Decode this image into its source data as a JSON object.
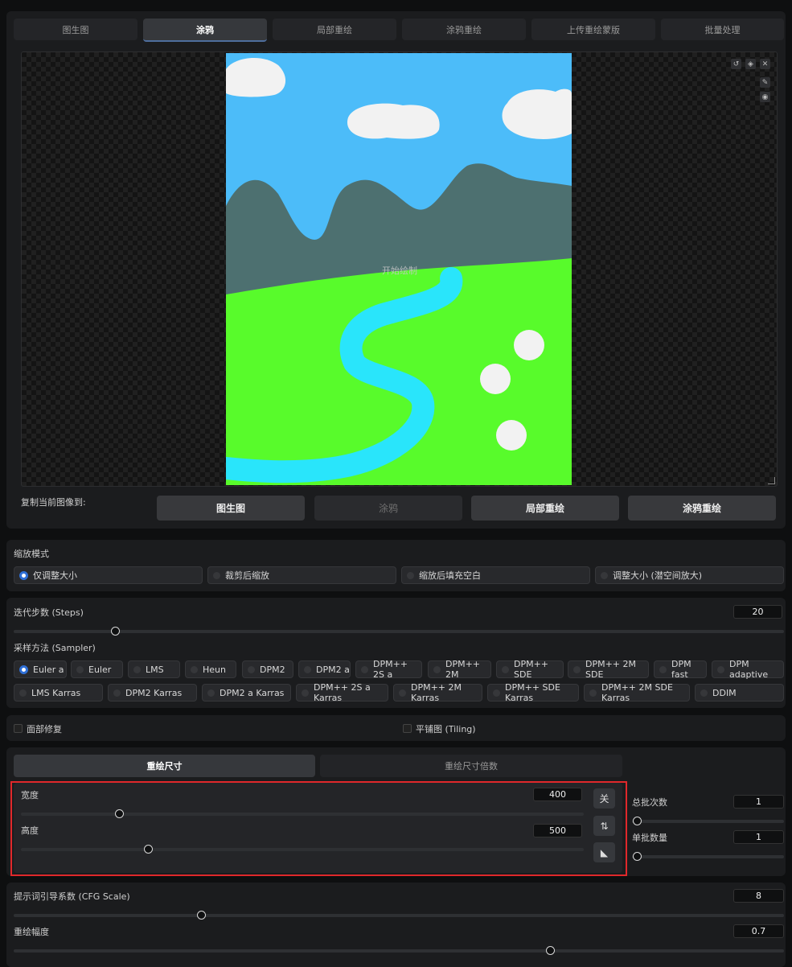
{
  "tabs": [
    "图生图",
    "涂鸦",
    "局部重绘",
    "涂鸦重绘",
    "上传重绘蒙版",
    "批量处理"
  ],
  "active_tab": "涂鸦",
  "canvas": {
    "hint": "开始绘制",
    "tools": [
      "undo-icon",
      "eraser-icon",
      "close-icon",
      "brush-icon",
      "color-picker-icon"
    ]
  },
  "copy_to": {
    "label": "复制当前图像到:",
    "buttons": [
      "图生图",
      "涂鸦",
      "局部重绘",
      "涂鸦重绘"
    ]
  },
  "resize_mode": {
    "label": "缩放模式",
    "options": [
      "仅调整大小",
      "裁剪后缩放",
      "缩放后填充空白",
      "调整大小 (潜空间放大)"
    ],
    "selected": "仅调整大小"
  },
  "steps": {
    "label": "迭代步数 (Steps)",
    "value": "20"
  },
  "sampler": {
    "label": "采样方法 (Sampler)",
    "row1": [
      "Euler a",
      "Euler",
      "LMS",
      "Heun",
      "DPM2",
      "DPM2 a",
      "DPM++ 2S a",
      "DPM++ 2M",
      "DPM++ SDE",
      "DPM++ 2M SDE",
      "DPM fast",
      "DPM adaptive"
    ],
    "row2": [
      "LMS Karras",
      "DPM2 Karras",
      "DPM2 a Karras",
      "DPM++ 2S a Karras",
      "DPM++ 2M Karras",
      "DPM++ SDE Karras",
      "DPM++ 2M SDE Karras",
      "DDIM"
    ],
    "selected": "Euler a"
  },
  "options": {
    "face_restore": "面部修复",
    "tiling": "平铺图 (Tiling)"
  },
  "size_tabs": [
    "重绘尺寸",
    "重绘尺寸倍数"
  ],
  "width": {
    "label": "宽度",
    "value": "400"
  },
  "height": {
    "label": "高度",
    "value": "500"
  },
  "size_buttons": {
    "close": "关",
    "swap": "⇅",
    "ratio": "◣"
  },
  "batch_count": {
    "label": "总批次数",
    "value": "1"
  },
  "batch_size": {
    "label": "单批数量",
    "value": "1"
  },
  "cfg": {
    "label": "提示词引导系数 (CFG Scale)",
    "value": "8"
  },
  "denoise": {
    "label": "重绘幅度",
    "value": "0.7"
  },
  "colors": {
    "accent": "#2f6fd6",
    "highlight": "#e0282b",
    "sky": "#4cbcf9",
    "grass": "#58fb2b",
    "river": "#29e5fb",
    "mountain": "#4d7070"
  }
}
